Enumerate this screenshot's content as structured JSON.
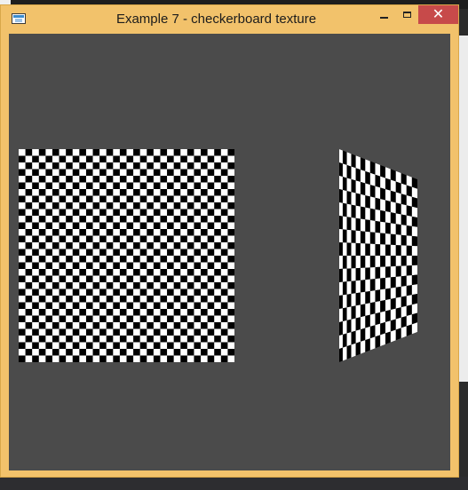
{
  "window": {
    "title": "Example 7 - checkerboard texture",
    "icon": "app-window-icon",
    "controls": {
      "minimize": "minimize-icon",
      "maximize": "maximize-icon",
      "close": "close-icon",
      "close_glyph": "✕"
    }
  },
  "colors": {
    "titlebar": "#f2c26b",
    "close_button": "#c74a4a",
    "viewport_background": "#4b4b4b",
    "checker_light": "#ffffff",
    "checker_dark": "#000000"
  },
  "scene": {
    "objects": [
      {
        "name": "front-facing checkerboard plane",
        "texture": "checkerboard"
      },
      {
        "name": "rotated checkerboard plane",
        "texture": "checkerboard"
      }
    ]
  }
}
